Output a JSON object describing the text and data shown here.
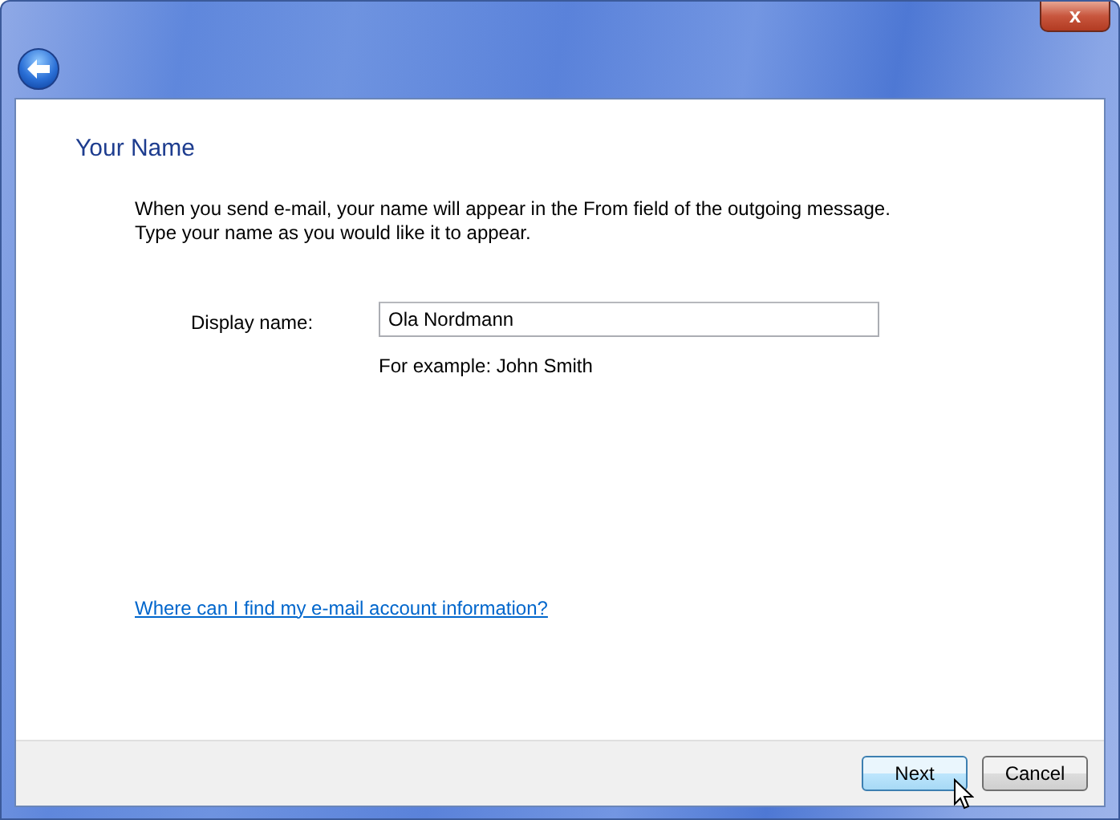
{
  "window": {
    "close_glyph": "x"
  },
  "page": {
    "title": "Your Name",
    "description": [
      "When you send e-mail, your name will appear in the From field of the outgoing message.",
      "Type your name as you would like it to appear."
    ],
    "field": {
      "label": "Display name:",
      "value": "Ola Nordmann",
      "hint": "For example: John Smith"
    },
    "link": "Where can I find my e-mail account information?"
  },
  "buttons": [
    {
      "label": "Next",
      "focused": true
    },
    {
      "label": "Cancel",
      "focused": false
    }
  ]
}
